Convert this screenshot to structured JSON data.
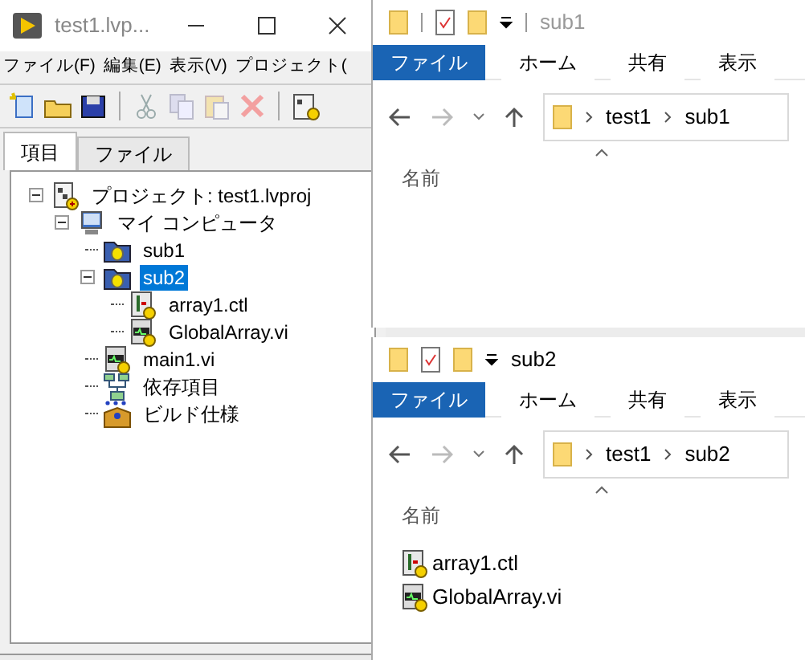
{
  "labview": {
    "title": "test1.lvp...",
    "menu": [
      "ファイル(F)",
      "編集(E)",
      "表示(V)",
      "プロジェクト("
    ],
    "tabs": [
      {
        "label": "項目",
        "selected": true
      },
      {
        "label": "ファイル",
        "selected": false
      }
    ],
    "tree": [
      {
        "label": "プロジェクト: test1.lvproj",
        "kind": "project",
        "expanded": true,
        "selected": false,
        "children": [
          {
            "label": "マイ コンピュータ",
            "kind": "computer",
            "expanded": true,
            "selected": false,
            "children": [
              {
                "label": "sub1",
                "kind": "folder",
                "selected": false
              },
              {
                "label": "sub2",
                "kind": "folder",
                "expanded": true,
                "selected": true,
                "children": [
                  {
                    "label": "array1.ctl",
                    "kind": "ctl",
                    "selected": false
                  },
                  {
                    "label": "GlobalArray.vi",
                    "kind": "vi",
                    "selected": false
                  }
                ]
              },
              {
                "label": "main1.vi",
                "kind": "vi",
                "selected": false
              },
              {
                "label": "依存項目",
                "kind": "deps",
                "selected": false
              },
              {
                "label": "ビルド仕様",
                "kind": "build",
                "selected": false
              }
            ]
          }
        ]
      }
    ]
  },
  "explorers": [
    {
      "title": "sub1",
      "ribbon_tabs": [
        {
          "label": "ファイル",
          "selected": true
        },
        {
          "label": "ホーム",
          "selected": false
        },
        {
          "label": "共有",
          "selected": false
        },
        {
          "label": "表示",
          "selected": false
        }
      ],
      "path": [
        "test1",
        "sub1"
      ],
      "column": "名前"
    },
    {
      "title": "sub2",
      "ribbon_tabs": [
        {
          "label": "ファイル",
          "selected": true
        },
        {
          "label": "ホーム",
          "selected": false
        },
        {
          "label": "共有",
          "selected": false
        },
        {
          "label": "表示",
          "selected": false
        }
      ],
      "path": [
        "test1",
        "sub2"
      ],
      "column": "名前",
      "files": [
        {
          "name": "array1.ctl",
          "kind": "ctl"
        },
        {
          "name": "GlobalArray.vi",
          "kind": "vi"
        }
      ]
    }
  ]
}
